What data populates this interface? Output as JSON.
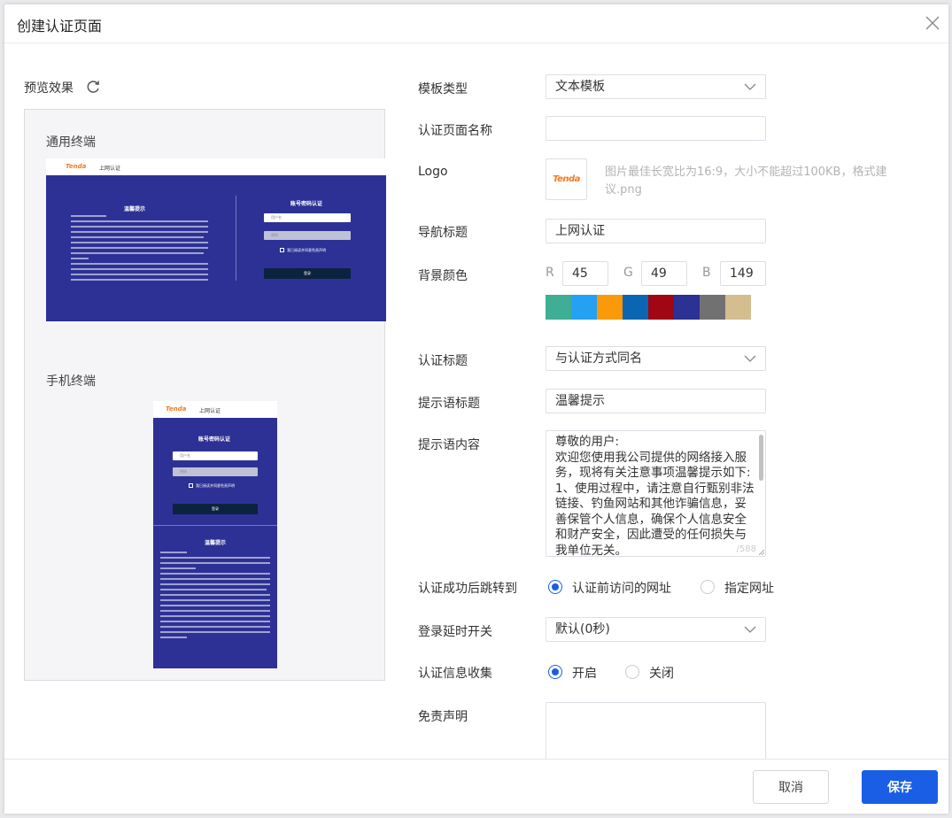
{
  "dialog": {
    "title": "创建认证页面",
    "cancel_label": "取消",
    "save_label": "保存"
  },
  "preview": {
    "label": "预览效果",
    "pc_label": "通用终端",
    "mobile_label": "手机终端",
    "mini_logo": "Tenda",
    "mini_nav": "上网认证",
    "mini_notice_title": "温馨提示",
    "mini_login_title": "账号密码认证",
    "mini_user_placeholder": "用户名",
    "mini_pass_placeholder": "密码",
    "mini_agree": "我已阅读并同意免责声明",
    "mini_login_btn": "登录"
  },
  "form": {
    "template_type": {
      "label": "模板类型",
      "value": "文本模板"
    },
    "page_name": {
      "label": "认证页面名称",
      "value": ""
    },
    "logo": {
      "label": "Logo",
      "mark": "Tenda",
      "hint": "图片最佳长宽比为16:9，大小不能超过100KB，格式建议.png"
    },
    "nav_title": {
      "label": "导航标题",
      "value": "上网认证"
    },
    "bg_color": {
      "label": "背景颜色",
      "r_label": "R",
      "r": "45",
      "g_label": "G",
      "g": "49",
      "b_label": "B",
      "b": "149",
      "swatches": [
        "#3fae94",
        "#25a1f3",
        "#fb9a08",
        "#0a66b3",
        "#a00712",
        "#2c3194",
        "#717171",
        "#d4bd8e"
      ]
    },
    "auth_title": {
      "label": "认证标题",
      "value": "与认证方式同名"
    },
    "tip_title": {
      "label": "提示语标题",
      "value": "温馨提示"
    },
    "tip_content": {
      "label": "提示语内容",
      "value": "尊敬的用户:\n欢迎您使用我公司提供的网络接入服务，现将有关注意事项温馨提示如下:\n1、使用过程中，请注意自行甄别非法链接、钓鱼网站和其他诈骗信息，妥善保管个人信息，确保个人信息安全和财产安全，因此遭受的任何损失与我单位无关。",
      "counter": "/588"
    },
    "redirect": {
      "label": "认证成功后跳转到",
      "option1": "认证前访问的网址",
      "option2": "指定网址",
      "selected": 1
    },
    "login_delay": {
      "label": "登录延时开关",
      "value": "默认(0秒)"
    },
    "info_collect": {
      "label": "认证信息收集",
      "option1": "开启",
      "option2": "关闭",
      "selected": 1
    },
    "disclaimer": {
      "label": "免责声明",
      "value": ""
    }
  }
}
